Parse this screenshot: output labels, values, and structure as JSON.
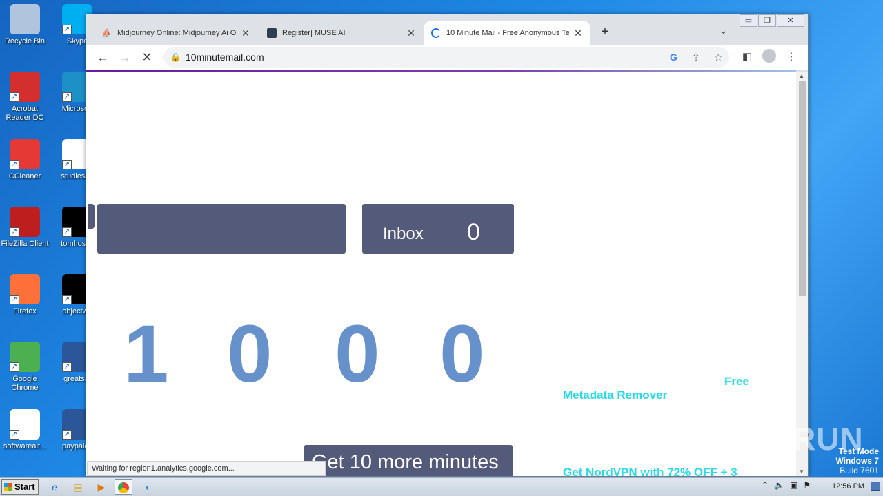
{
  "desktop": {
    "icons": [
      {
        "label": "Recycle Bin",
        "icon": "recycle-bin-icon",
        "color": "#b0c4de"
      },
      {
        "label": "Skype",
        "icon": "skype-icon",
        "color": "#00aff0"
      },
      {
        "label": "Acrobat Reader DC",
        "icon": "acrobat-icon",
        "color": "#d32f2f"
      },
      {
        "label": "Microsoft",
        "icon": "edge-icon",
        "color": "#1e90c8"
      },
      {
        "label": "CCleaner",
        "icon": "ccleaner-icon",
        "color": "#e53935"
      },
      {
        "label": "studiesag",
        "icon": "blank-file-icon",
        "color": "#ffffff"
      },
      {
        "label": "FileZilla Client",
        "icon": "filezilla-icon",
        "color": "#bf1e1e"
      },
      {
        "label": "tomhostin",
        "icon": "black-file-icon",
        "color": "#000000"
      },
      {
        "label": "Firefox",
        "icon": "firefox-icon",
        "color": "#ff7139"
      },
      {
        "label": "objectwo",
        "icon": "black-file-icon",
        "color": "#000000"
      },
      {
        "label": "Google Chrome",
        "icon": "chrome-icon",
        "color": "#4caf50"
      },
      {
        "label": "greatsaf",
        "icon": "word-doc-icon",
        "color": "#2b579a"
      },
      {
        "label": "softwarealt...",
        "icon": "blank-file-icon",
        "color": "#ffffff"
      },
      {
        "label": "paypalca",
        "icon": "word-doc-icon",
        "color": "#2b579a"
      }
    ]
  },
  "browser": {
    "tabs": [
      {
        "title": "Midjourney Online: Midjourney Ai On",
        "icon": "midjourney-icon"
      },
      {
        "title": "Register| MUSE AI",
        "icon": "muse-icon"
      },
      {
        "title": "10 Minute Mail - Free Anonymous Te",
        "icon": "loading-spinner-icon",
        "active": true
      }
    ],
    "new_tab": "+",
    "tab_dropdown": "⌄",
    "window_controls": {
      "minimize": "▭",
      "restore": "❐",
      "close": "✕"
    },
    "url": "10minutemail.com",
    "status_text": "Waiting for region1.analytics.google.com..."
  },
  "page": {
    "inbox_label": "Inbox",
    "inbox_count": "0",
    "timer_digits": [
      "1",
      "0",
      "0",
      "0"
    ],
    "free_link": "Free",
    "metadata_link": "Metadata Remover",
    "more_minutes": "Get 10 more minutes",
    "nordvpn_link": "Get NordVPN with 72% OFF + 3"
  },
  "overlay": {
    "watermark": "ANY RUN",
    "test_mode_1": "Test Mode",
    "test_mode_2": "Windows 7",
    "test_mode_3": "Build 7601"
  },
  "taskbar": {
    "start": "Start",
    "clock": "12:56 PM"
  }
}
